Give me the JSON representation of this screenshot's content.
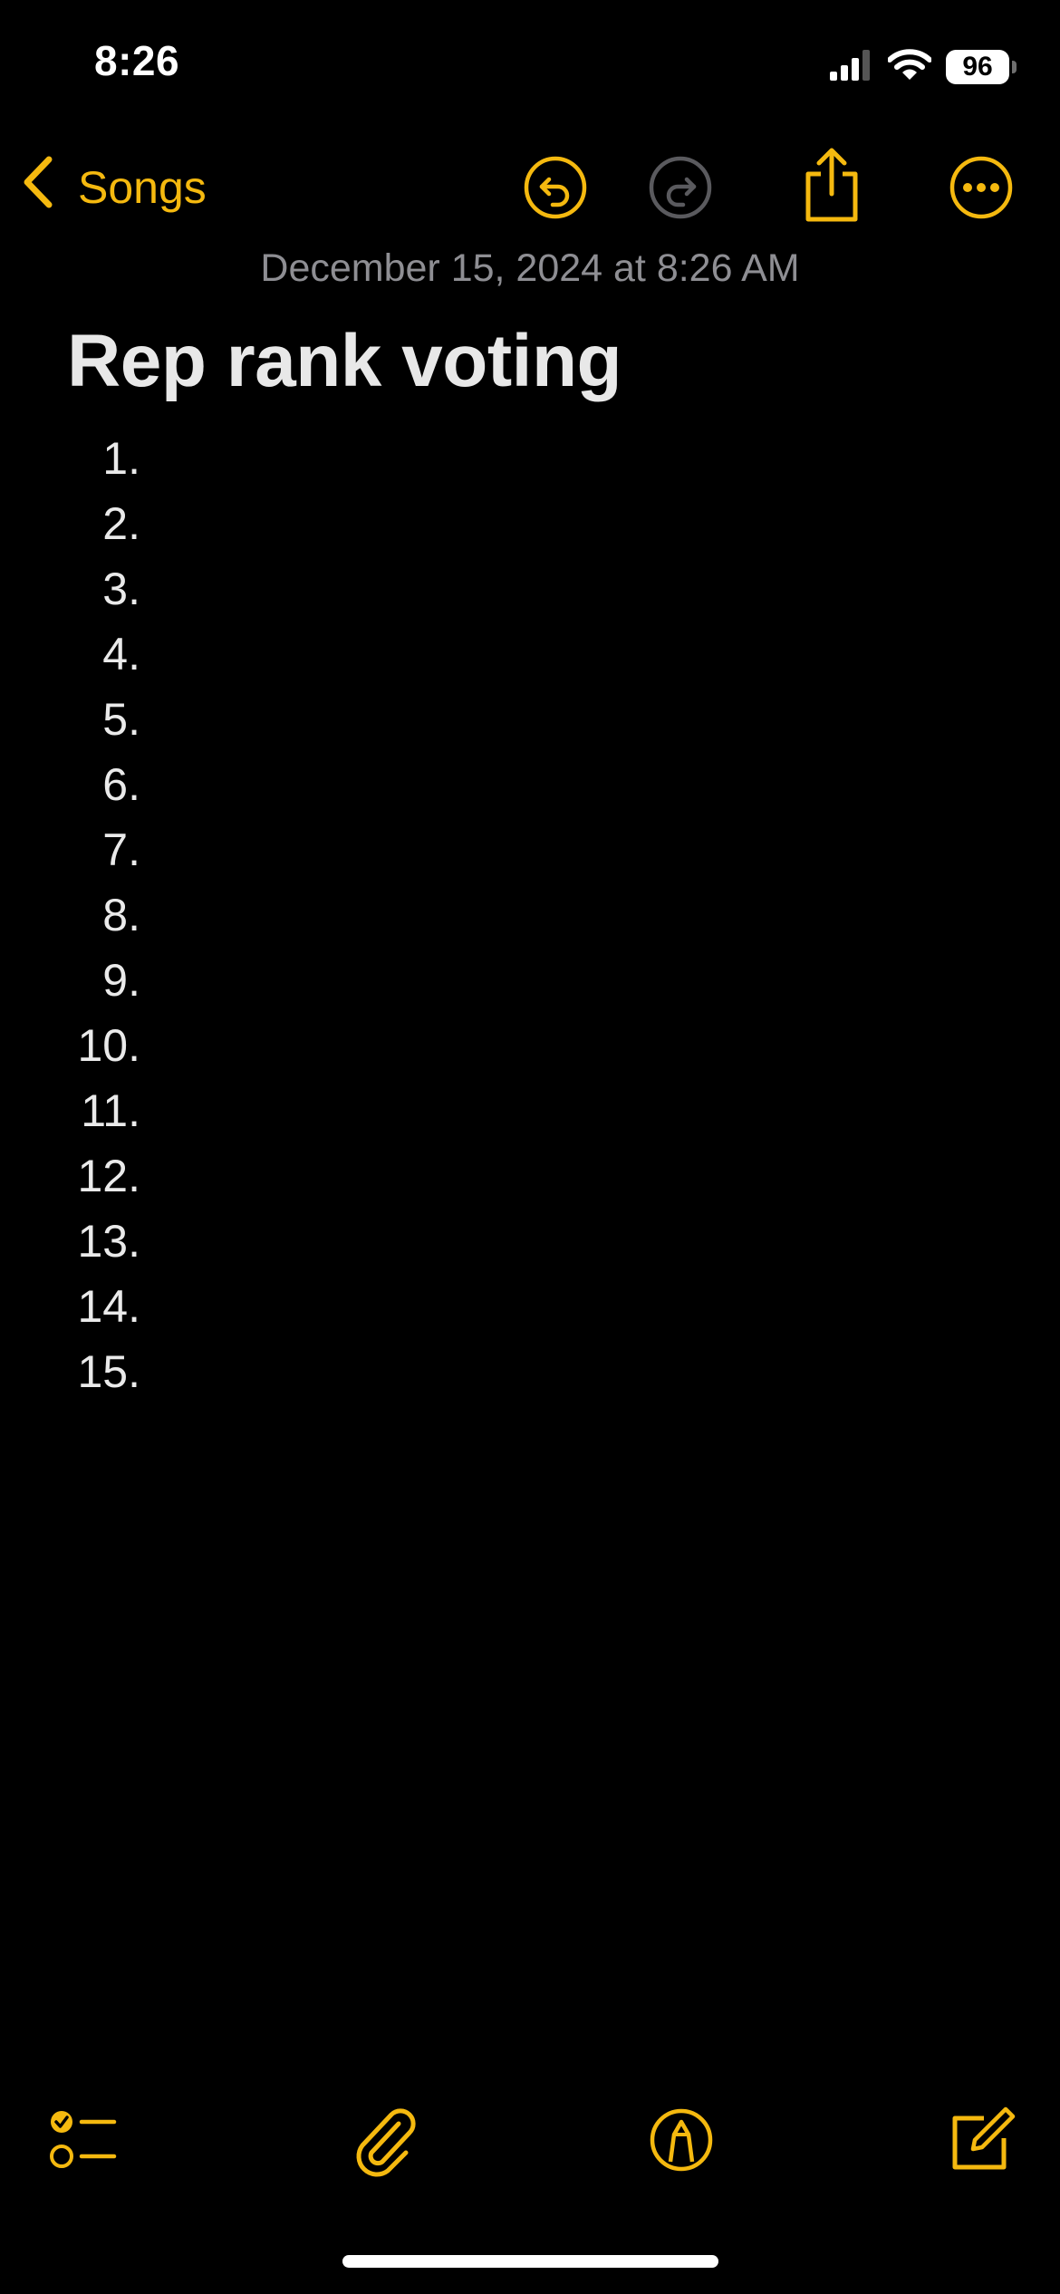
{
  "status_bar": {
    "time": "8:26",
    "battery": "96",
    "icons": [
      "cellular-signal-icon",
      "wifi-icon",
      "battery-icon"
    ]
  },
  "nav": {
    "back_label": "Songs",
    "icons": [
      "chevron-left-icon",
      "undo-icon",
      "redo-icon",
      "share-icon",
      "more-icon"
    ],
    "redo_enabled": false
  },
  "note": {
    "date": "December 15, 2024 at 8:26 AM",
    "title": "Rep rank voting",
    "list": [
      "1.",
      "2.",
      "3.",
      "4.",
      "5.",
      "6.",
      "7.",
      "8.",
      "9.",
      "10.",
      "11.",
      "12.",
      "13.",
      "14.",
      "15."
    ]
  },
  "toolbar": {
    "icons": [
      "checklist-icon",
      "attachment-icon",
      "markup-icon",
      "compose-icon"
    ]
  },
  "colors": {
    "accent": "#f5b90f",
    "background": "#000000",
    "text": "#e8e8e8",
    "secondary_text": "#8e8e93",
    "disabled": "#5a5a5e"
  }
}
